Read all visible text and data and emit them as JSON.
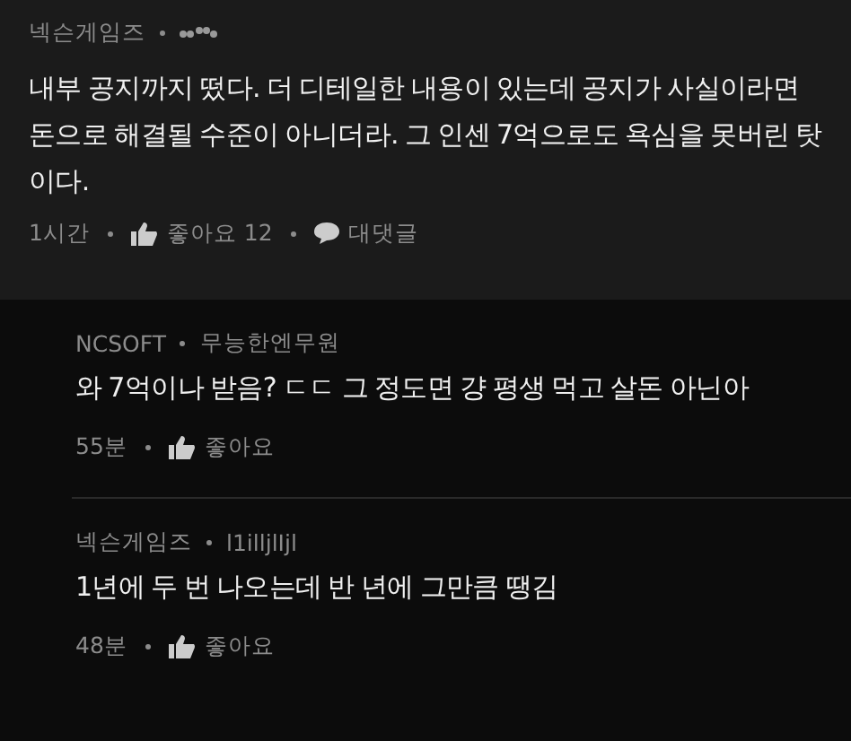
{
  "comment": {
    "author": "넥슨게임즈",
    "text": "내부 공지까지 떴다. 더 디테일한 내용이 있는데 공지가 사실이라면 돈으로 해결될 수준이 아니더라. 그 인센 7억으로도 욕심을 못버린 탓이다.",
    "time": "1시간",
    "like": "좋아요 12",
    "reply": "대댓글"
  },
  "replies": [
    {
      "company": "NCSOFT",
      "author": "무능한엔무원",
      "text": "와 7억이나 받음? ㄷㄷ 그 정도면 걍 평생 먹고 살돈 아닌아",
      "time": "55분",
      "like": "좋아요"
    },
    {
      "company": "넥슨게임즈",
      "author": "l1illjlIjl",
      "text": "1년에 두 번 나오는데 반 년에 그만큼 땡김",
      "time": "48분",
      "like": "좋아요"
    }
  ]
}
